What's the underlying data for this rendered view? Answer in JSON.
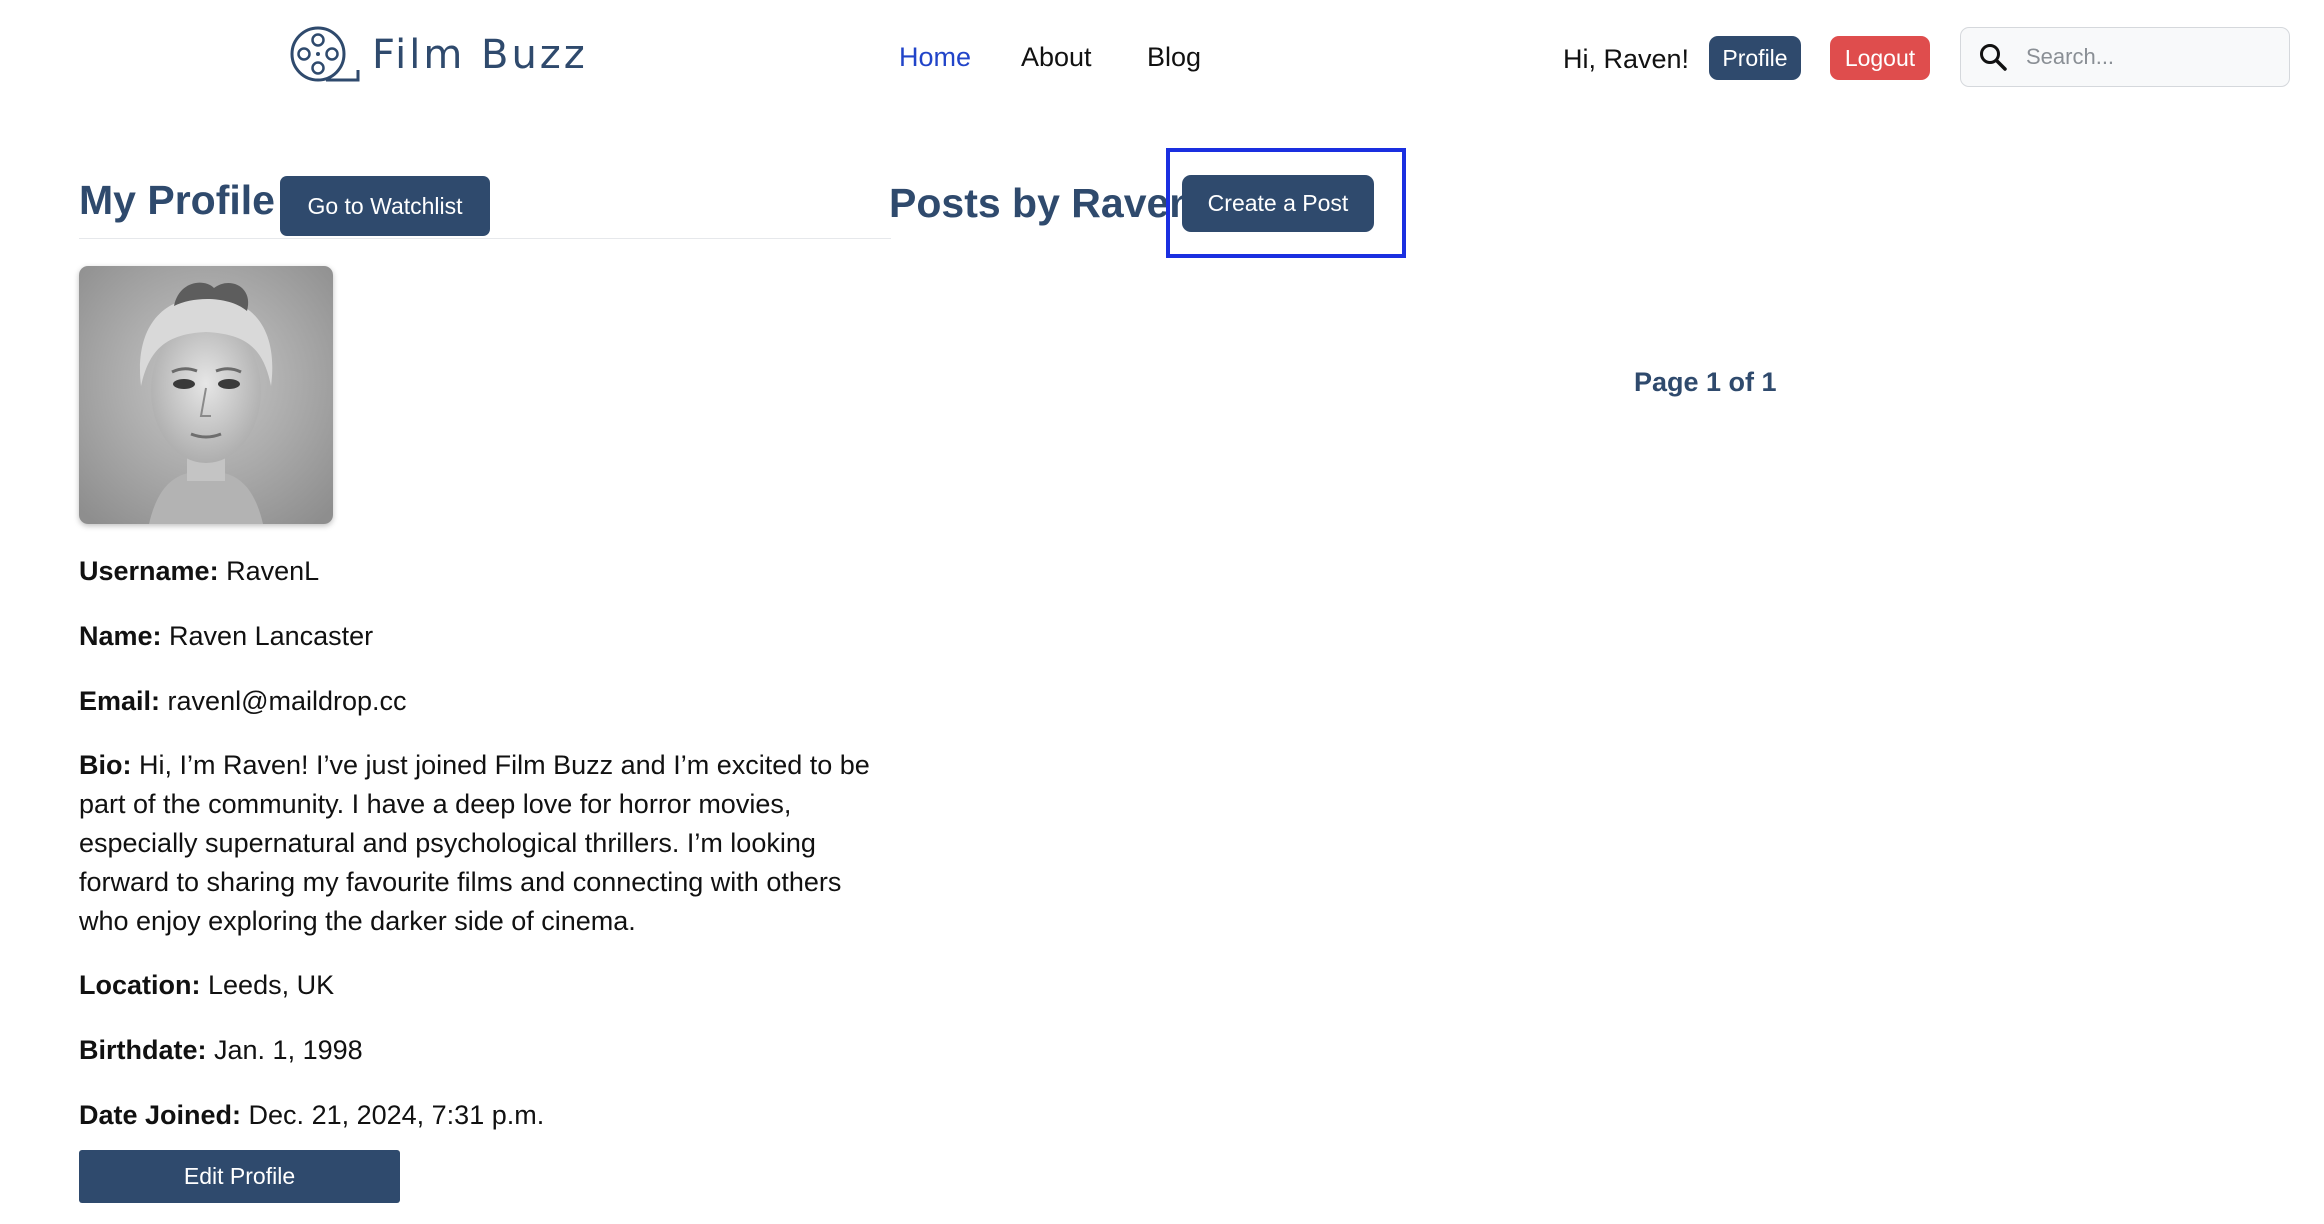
{
  "brand": {
    "name": "Film Buzz"
  },
  "nav": {
    "items": [
      {
        "label": "Home",
        "active": true
      },
      {
        "label": "About",
        "active": false
      },
      {
        "label": "Blog",
        "active": false
      }
    ]
  },
  "user_area": {
    "greeting": "Hi, Raven!",
    "profile_label": "Profile",
    "logout_label": "Logout"
  },
  "search": {
    "placeholder": "Search...",
    "value": ""
  },
  "profile": {
    "title": "My Profile",
    "watchlist_button": "Go to Watchlist",
    "fields": [
      {
        "label": "Username:",
        "value": "RavenL"
      },
      {
        "label": "Name:",
        "value": "Raven Lancaster"
      },
      {
        "label": "Email:",
        "value": "ravenl@maildrop.cc"
      },
      {
        "label": "Bio:",
        "value": "Hi, I’m Raven! I’ve just joined Film Buzz and I’m excited to be part of the community. I have a deep love for horror movies, especially supernatural and psychological thrillers. I’m looking forward to sharing my favourite films and connecting with others who enjoy exploring the darker side of cinema."
      },
      {
        "label": "Location:",
        "value": "Leeds, UK"
      },
      {
        "label": "Birthdate:",
        "value": "Jan. 1, 1998"
      },
      {
        "label": "Date Joined:",
        "value": "Dec. 21, 2024, 7:31 p.m."
      }
    ],
    "edit_button": "Edit Profile"
  },
  "posts": {
    "title": "Posts by Raven",
    "create_button": "Create a Post",
    "pagination": "Page 1 of 1"
  },
  "colors": {
    "primary": "#2f4a6d",
    "danger": "#df4d4d",
    "nav_active": "#2144c9",
    "highlight_box": "#1a2fe0"
  },
  "icons": {
    "logo": "film-reel-icon",
    "search": "search-icon",
    "avatar": "user-photo"
  }
}
